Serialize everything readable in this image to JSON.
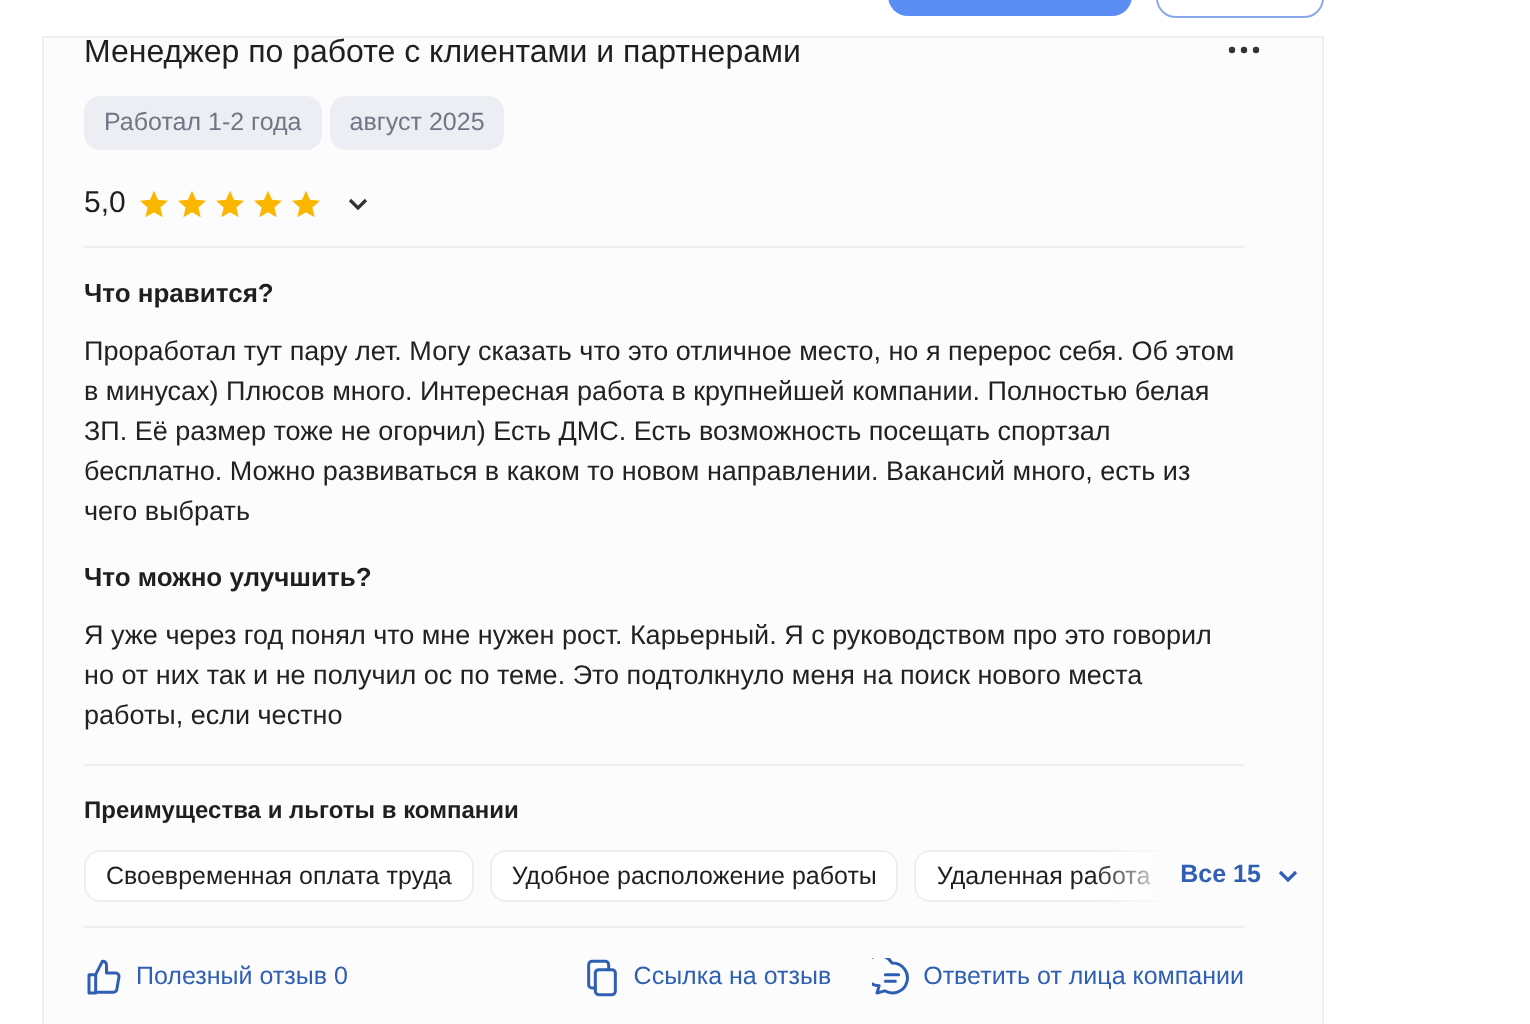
{
  "review": {
    "title": "Менеджер по работе с клиентами и партнерами",
    "tags": [
      "Работал 1-2 года",
      "август 2025"
    ],
    "rating": "5,0",
    "stars": 5,
    "sections": [
      {
        "heading": "Что нравится?",
        "text": "Проработал тут пару лет. Могу сказать что это отличное место, но я перерос себя. Об этом в минусах) Плюсов много. Интересная работа в крупнейшей компании. Полностью белая ЗП. Её размер тоже не огорчил) Есть ДМС. Есть возможность посещать спортзал бесплатно. Можно развиваться в каком то новом направлении. Вакансий много, есть из чего выбрать"
      },
      {
        "heading": "Что можно улучшить?",
        "text": "Я уже через год понял что мне нужен рост. Карьерный. Я с руководством про это говорил но от них так и не получил ос по теме. Это подтолкнуло меня на поиск нового места работы, если честно"
      }
    ],
    "benefits": {
      "heading": "Преимущества и льготы в компании",
      "items": [
        "Своевременная оплата труда",
        "Удобное расположение работы",
        "Удаленная работа"
      ],
      "more": "Все 15"
    },
    "actions": [
      {
        "kind": "like",
        "label": "Полезный отзыв 0"
      },
      {
        "kind": "link",
        "label": "Ссылка на отзыв"
      },
      {
        "kind": "reply",
        "label": "Ответить от лица компании"
      }
    ]
  }
}
